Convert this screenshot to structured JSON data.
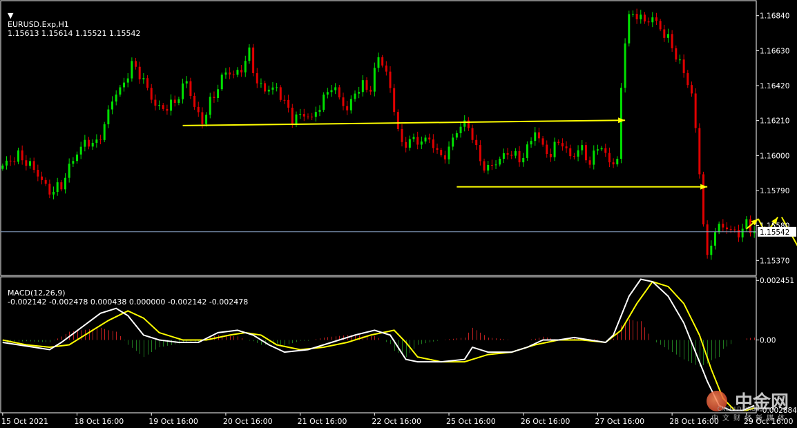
{
  "colors": {
    "background": "#000000",
    "bull": "#00e000",
    "bear": "#e00000",
    "grid": "#ffffff",
    "macd_main": "#ffffff",
    "macd_signal": "#ffff00",
    "hist_pos": "#c02020",
    "hist_neg": "#1f7a1f",
    "annotation": "#ffff00",
    "price_line": "#8aa4c8"
  },
  "header": {
    "symbol_label": "EURUSD.Exp,H1",
    "ohlc": "1.15613 1.15614 1.15521 1.15542"
  },
  "macd_header": {
    "label": "MACD(12,26,9)",
    "values": "-0.002142 -0.002478 0.000438 0.000000 -0.002142 -0.002478"
  },
  "price_axis": {
    "ticks": [
      "1.16840",
      "1.16630",
      "1.16420",
      "1.16210",
      "1.16000",
      "1.15790",
      "1.15580",
      "1.15370"
    ],
    "current_price": "1.15542"
  },
  "macd_axis": {
    "ticks": [
      "0.002451",
      "0.00",
      "-0.002884"
    ]
  },
  "time_axis": {
    "labels": [
      "15 Oct 2021",
      "18 Oct 16:00",
      "19 Oct 16:00",
      "20 Oct 16:00",
      "21 Oct 16:00",
      "22 Oct 16:00",
      "25 Oct 16:00",
      "26 Oct 16:00",
      "27 Oct 16:00",
      "28 Oct 16:00",
      "29 Oct 16:00"
    ]
  },
  "watermark": {
    "title": "中金网",
    "subtitle": "中文财经新媒体",
    "site": "CNGOLD.ORG"
  },
  "chart_data": [
    {
      "type": "candlestick",
      "symbol": "EURUSD.Exp",
      "timeframe": "H1",
      "ylim": [
        1.1528,
        1.1693
      ],
      "close_path": [
        [
          0,
          1.1594
        ],
        [
          4,
          1.16
        ],
        [
          8,
          1.1592
        ],
        [
          12,
          1.1578
        ],
        [
          15,
          1.1582
        ],
        [
          18,
          1.1598
        ],
        [
          21,
          1.1608
        ],
        [
          24,
          1.1607
        ],
        [
          26,
          1.1618
        ],
        [
          28,
          1.1634
        ],
        [
          31,
          1.1643
        ],
        [
          33,
          1.1655
        ],
        [
          35,
          1.1649
        ],
        [
          37,
          1.164
        ],
        [
          39,
          1.163
        ],
        [
          41,
          1.1628
        ],
        [
          44,
          1.1632
        ],
        [
          47,
          1.1645
        ],
        [
          49,
          1.1629
        ],
        [
          51,
          1.162
        ],
        [
          53,
          1.1632
        ],
        [
          55,
          1.1641
        ],
        [
          57,
          1.1651
        ],
        [
          59,
          1.1648
        ],
        [
          61,
          1.1652
        ],
        [
          63,
          1.1662
        ],
        [
          65,
          1.1643
        ],
        [
          67,
          1.164
        ],
        [
          70,
          1.164
        ],
        [
          72,
          1.1632
        ],
        [
          74,
          1.1622
        ],
        [
          77,
          1.1625
        ],
        [
          79,
          1.1622
        ],
        [
          81,
          1.163
        ],
        [
          84,
          1.1642
        ],
        [
          86,
          1.1635
        ],
        [
          88,
          1.1627
        ],
        [
          90,
          1.1638
        ],
        [
          92,
          1.1642
        ],
        [
          94,
          1.164
        ],
        [
          96,
          1.166
        ],
        [
          98,
          1.165
        ],
        [
          100,
          1.1628
        ],
        [
          102,
          1.1605
        ],
        [
          104,
          1.161
        ],
        [
          106,
          1.1608
        ],
        [
          108,
          1.161
        ],
        [
          110,
          1.1607
        ],
        [
          112,
          1.1598
        ],
        [
          114,
          1.1604
        ],
        [
          116,
          1.1615
        ],
        [
          118,
          1.162
        ],
        [
          120,
          1.1612
        ],
        [
          122,
          1.1596
        ],
        [
          124,
          1.1592
        ],
        [
          126,
          1.1596
        ],
        [
          128,
          1.16
        ],
        [
          130,
          1.1602
        ],
        [
          132,
          1.1597
        ],
        [
          134,
          1.1604
        ],
        [
          136,
          1.1615
        ],
        [
          138,
          1.1605
        ],
        [
          140,
          1.16
        ],
        [
          142,
          1.161
        ],
        [
          144,
          1.1602
        ],
        [
          146,
          1.16
        ],
        [
          148,
          1.1605
        ],
        [
          150,
          1.1594
        ],
        [
          152,
          1.1607
        ],
        [
          154,
          1.16
        ],
        [
          156,
          1.1595
        ],
        [
          157,
          1.1597
        ],
        [
          158,
          1.164
        ],
        [
          159,
          1.167
        ],
        [
          160,
          1.1683
        ],
        [
          162,
          1.1685
        ],
        [
          164,
          1.168
        ],
        [
          166,
          1.1683
        ],
        [
          168,
          1.1676
        ],
        [
          170,
          1.167
        ],
        [
          172,
          1.166
        ],
        [
          174,
          1.165
        ],
        [
          176,
          1.1637
        ],
        [
          177,
          1.1615
        ],
        [
          178,
          1.159
        ],
        [
          179,
          1.156
        ],
        [
          180,
          1.1537
        ],
        [
          181,
          1.1548
        ],
        [
          182,
          1.1555
        ],
        [
          184,
          1.1558
        ],
        [
          186,
          1.1555
        ],
        [
          188,
          1.1553
        ],
        [
          190,
          1.1559
        ],
        [
          192,
          1.1554
        ]
      ],
      "annotations": [
        {
          "type": "arrow",
          "from": [
            46,
            1.1618
          ],
          "to": [
            159,
            1.16212
          ],
          "label": ""
        },
        {
          "type": "arrow",
          "from": [
            116,
            1.15812
          ],
          "to": [
            180,
            1.15812
          ],
          "label": ""
        },
        {
          "type": "arrow",
          "from": [
            190,
            1.1556
          ],
          "to": [
            193,
            1.1562
          ],
          "label": ""
        },
        {
          "type": "arrow",
          "from": [
            193,
            1.1562
          ],
          "to": [
            195,
            1.1553
          ],
          "label": ""
        },
        {
          "type": "arrow",
          "from": [
            195,
            1.1553
          ],
          "to": [
            198,
            1.1563
          ],
          "label": ""
        },
        {
          "type": "arrow",
          "from": [
            199,
            1.1563
          ],
          "to": [
            207,
            1.1529
          ],
          "label": ""
        }
      ]
    },
    {
      "type": "line",
      "indicator": "MACD(12,26,9)",
      "ylim": [
        -0.003,
        0.0026
      ],
      "series": [
        {
          "name": "main",
          "points": [
            [
              0,
              -0.0001
            ],
            [
              6,
              -0.00025
            ],
            [
              12,
              -0.0004
            ],
            [
              15,
              -0.0001
            ],
            [
              20,
              0.0005
            ],
            [
              25,
              0.0011
            ],
            [
              29,
              0.0013
            ],
            [
              32,
              0.001
            ],
            [
              36,
              0.0002
            ],
            [
              40,
              0.0
            ],
            [
              45,
              -0.0001
            ],
            [
              50,
              -0.0001
            ],
            [
              55,
              0.0003
            ],
            [
              60,
              0.0004
            ],
            [
              64,
              0.0002
            ],
            [
              68,
              -0.0002
            ],
            [
              72,
              -0.0005
            ],
            [
              78,
              -0.0004
            ],
            [
              84,
              -0.0001
            ],
            [
              90,
              0.0002
            ],
            [
              95,
              0.0004
            ],
            [
              99,
              0.0002
            ],
            [
              103,
              -0.0008
            ],
            [
              106,
              -0.0009
            ],
            [
              112,
              -0.0009
            ],
            [
              118,
              -0.0008
            ],
            [
              120,
              -0.0003
            ],
            [
              124,
              -0.0005
            ],
            [
              130,
              -0.0005
            ],
            [
              134,
              -0.0003
            ],
            [
              138,
              0.0
            ],
            [
              142,
              0.0
            ],
            [
              146,
              0.0001
            ],
            [
              150,
              0.0
            ],
            [
              154,
              -0.0001
            ],
            [
              156,
              0.0002
            ],
            [
              160,
              0.0018
            ],
            [
              163,
              0.0025
            ],
            [
              166,
              0.0024
            ],
            [
              170,
              0.0018
            ],
            [
              174,
              0.0007
            ],
            [
              177,
              -0.0005
            ],
            [
              180,
              -0.0017
            ],
            [
              183,
              -0.0027
            ],
            [
              186,
              -0.0029
            ],
            [
              189,
              -0.0029
            ],
            [
              192,
              -0.0027
            ]
          ]
        },
        {
          "name": "signal",
          "points": [
            [
              0,
              0.0
            ],
            [
              6,
              -0.0002
            ],
            [
              12,
              -0.0003
            ],
            [
              17,
              -0.0002
            ],
            [
              22,
              0.0003
            ],
            [
              27,
              0.0008
            ],
            [
              32,
              0.0012
            ],
            [
              36,
              0.0009
            ],
            [
              40,
              0.0003
            ],
            [
              46,
              0.0
            ],
            [
              52,
              0.0
            ],
            [
              58,
              0.0002
            ],
            [
              62,
              0.0003
            ],
            [
              66,
              0.0002
            ],
            [
              70,
              -0.0002
            ],
            [
              76,
              -0.0004
            ],
            [
              82,
              -0.0003
            ],
            [
              88,
              -0.0001
            ],
            [
              94,
              0.0002
            ],
            [
              100,
              0.0004
            ],
            [
              103,
              -0.0001
            ],
            [
              106,
              -0.0007
            ],
            [
              112,
              -0.0009
            ],
            [
              118,
              -0.0009
            ],
            [
              124,
              -0.0006
            ],
            [
              130,
              -0.0005
            ],
            [
              136,
              -0.0002
            ],
            [
              142,
              0.0
            ],
            [
              148,
              0.0
            ],
            [
              154,
              -0.0001
            ],
            [
              158,
              0.0004
            ],
            [
              162,
              0.0015
            ],
            [
              166,
              0.0024
            ],
            [
              170,
              0.0022
            ],
            [
              174,
              0.0015
            ],
            [
              178,
              0.0002
            ],
            [
              181,
              -0.0012
            ],
            [
              184,
              -0.0024
            ],
            [
              187,
              -0.0029
            ],
            [
              190,
              -0.0029
            ],
            [
              192,
              -0.0028
            ]
          ]
        }
      ],
      "histogram": {
        "name": "OsMA",
        "note": "difference between main and signal, red positive, green negative"
      }
    }
  ]
}
